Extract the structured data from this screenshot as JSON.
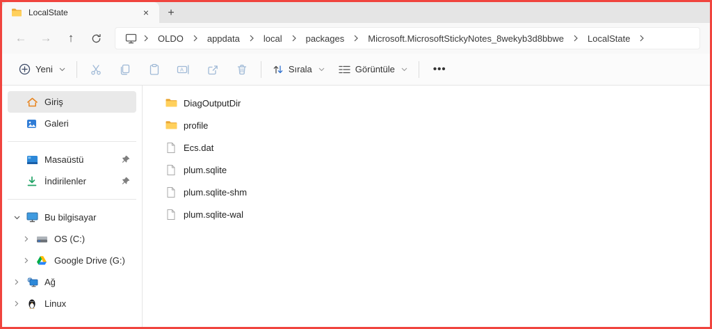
{
  "colors": {
    "annotation_border": "#f0443e",
    "folder_yellow": "#ffd05c",
    "accent_blue": "#2d6fce",
    "selection_gray": "#e9e9e9",
    "disabled_icon_blue": "#9fb9d6"
  },
  "tab_bar": {
    "active_tab": {
      "title": "LocalState"
    },
    "close_label": "×",
    "new_tab_label": "+"
  },
  "navigation": {
    "back_label": "←",
    "forward_label": "→",
    "up_label": "↑",
    "breadcrumb": {
      "items": [
        "OLDO",
        "appdata",
        "local",
        "packages",
        "Microsoft.MicrosoftStickyNotes_8wekyb3d8bbwe",
        "LocalState"
      ]
    }
  },
  "toolbar": {
    "new_label": "Yeni",
    "sort_label": "Sırala",
    "view_label": "Görüntüle",
    "more_label": "•••"
  },
  "sidebar": {
    "items": [
      {
        "label": "Giriş",
        "selected": true
      },
      {
        "label": "Galeri"
      },
      {
        "label": "Masaüstü",
        "pinned": true
      },
      {
        "label": "İndirilenler",
        "pinned": true
      },
      {
        "label": "Bu bilgisayar",
        "expanded": true
      },
      {
        "label": "OS (C:)"
      },
      {
        "label": "Google Drive (G:)"
      },
      {
        "label": "Ağ"
      },
      {
        "label": "Linux"
      }
    ]
  },
  "files": {
    "items": [
      {
        "name": "DiagOutputDir",
        "type": "folder"
      },
      {
        "name": "profile",
        "type": "folder"
      },
      {
        "name": "Ecs.dat",
        "type": "file"
      },
      {
        "name": "plum.sqlite",
        "type": "file"
      },
      {
        "name": "plum.sqlite-shm",
        "type": "file"
      },
      {
        "name": "plum.sqlite-wal",
        "type": "file"
      }
    ]
  }
}
